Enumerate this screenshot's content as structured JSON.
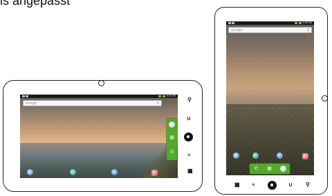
{
  "caption": {
    "text": "ls angepasst"
  },
  "landscape": {
    "status_time": "6:30 PM",
    "search_placeholder": "Google",
    "dock": [
      "compass",
      "grid",
      "phone"
    ]
  },
  "portrait": {
    "status_time": "6:30 PM",
    "search_placeholder": "Google",
    "dock": [
      "phone",
      "grid",
      "compass"
    ]
  },
  "icons": {
    "camera": "camera-icon",
    "search": "search-icon",
    "menu": "menu-icon",
    "back": "back-icon",
    "home": "home-icon",
    "volume": "volume-icon",
    "power": "power-icon"
  },
  "colors": {
    "dock": "#55a82b",
    "bezel": "#ffffff",
    "outline": "#222222"
  }
}
